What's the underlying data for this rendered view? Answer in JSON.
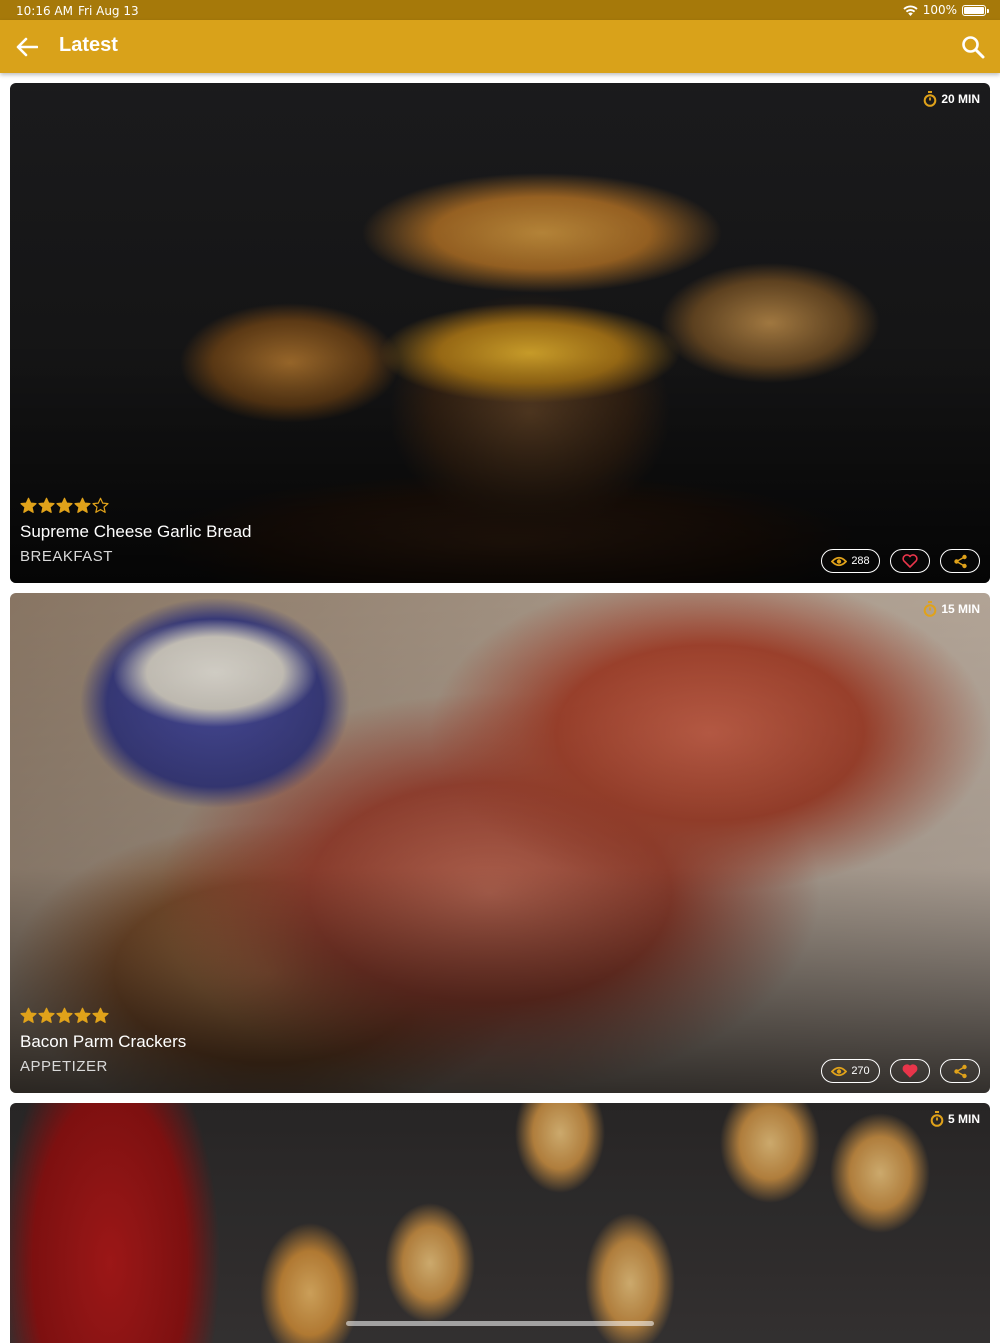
{
  "status_bar": {
    "time": "10:16 AM",
    "date": "Fri Aug 13",
    "battery": "100%"
  },
  "app_bar": {
    "title": "Latest",
    "back_icon": "arrow-left-icon",
    "search_icon": "search-icon"
  },
  "colors": {
    "accent": "#d9a21a",
    "star": "#e0a21a"
  },
  "recipes": [
    {
      "time": "20 MIN",
      "rating": 4,
      "title": "Supreme Cheese Garlic Bread",
      "category": "BREAKFAST",
      "views": "288",
      "favorited": false
    },
    {
      "time": "15 MIN",
      "rating": 5,
      "title": "Bacon Parm Crackers",
      "category": "APPETIZER",
      "views": "270",
      "favorited": true
    },
    {
      "time": "5 MIN"
    }
  ]
}
